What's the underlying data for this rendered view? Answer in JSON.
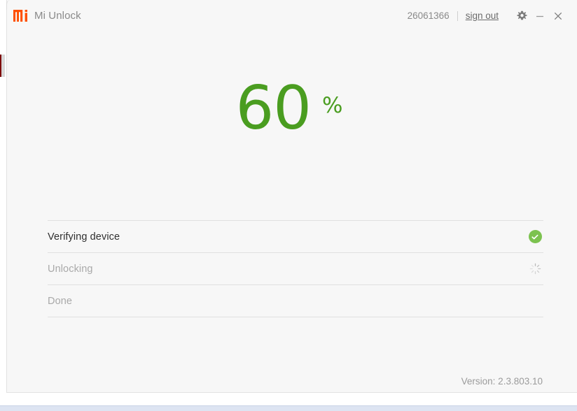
{
  "window": {
    "app_title": "Mi Unlock",
    "logo_icon": "mi-logo-icon",
    "logo_color": "#ff5000",
    "background": "#f7f7f7"
  },
  "titlebar": {
    "account_id": "26061366",
    "sign_out_label": "sign out",
    "settings_icon": "gear-icon",
    "minimize_icon": "minimize-icon",
    "close_icon": "close-icon"
  },
  "progress": {
    "value": "60",
    "unit": "%",
    "color": "#4a9d20"
  },
  "steps": [
    {
      "label": "Verifying device",
      "state": "complete",
      "status_icon": "check-circle-icon"
    },
    {
      "label": "Unlocking",
      "state": "in-progress",
      "status_icon": "loading-spinner-icon"
    },
    {
      "label": "Done",
      "state": "pending",
      "status_icon": ""
    }
  ],
  "footer": {
    "version_label": "Version: 2.3.803.10"
  }
}
